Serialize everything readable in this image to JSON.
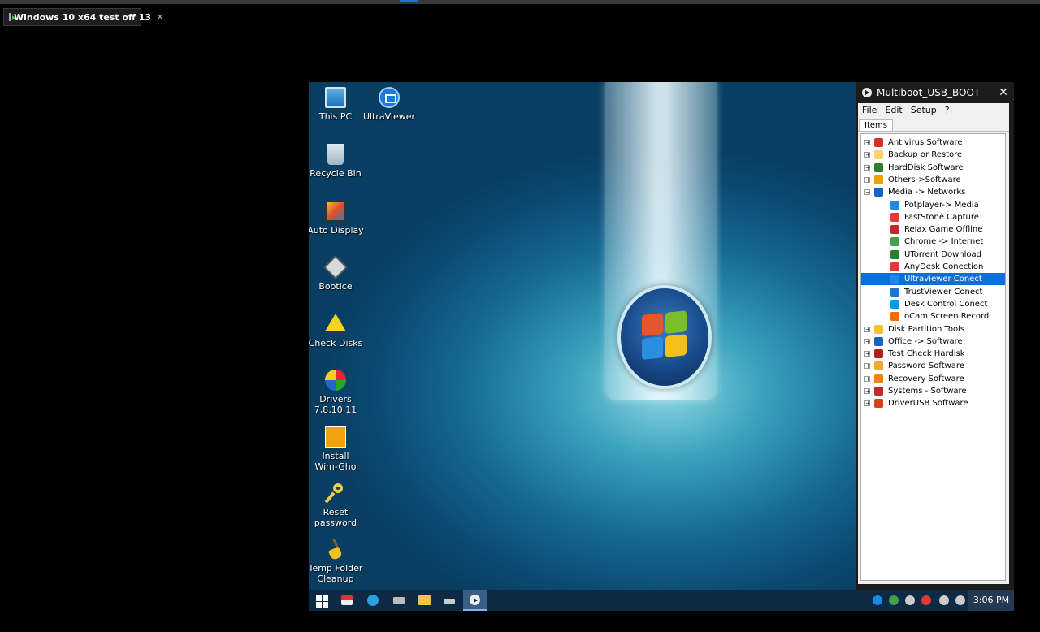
{
  "host": {
    "tab_title": "Windows 10 x64 test off 13",
    "tab_close": "✕"
  },
  "desktop": {
    "icons": [
      {
        "label": "This PC",
        "icon": "computer-icon"
      },
      {
        "label": "UltraViewer",
        "icon": "ultraviewer-icon"
      },
      {
        "label": "Recycle Bin",
        "icon": "recycle-bin-icon"
      },
      {
        "label": "Auto Display",
        "icon": "display-icon"
      },
      {
        "label": "Bootice",
        "icon": "bootice-icon"
      },
      {
        "label": "Check Disks",
        "icon": "warning-disk-icon"
      },
      {
        "label": "Drivers\n7,8,10,11",
        "icon": "drivers-icon"
      },
      {
        "label": "Install\nWim-Gho",
        "icon": "windows-installer-icon"
      },
      {
        "label": "Reset\npassword",
        "icon": "key-icon"
      },
      {
        "label": "Temp Folder\nCleanup",
        "icon": "broom-icon"
      }
    ]
  },
  "multiboot": {
    "title": "Multiboot_USB_BOOT",
    "close": "✕",
    "menu": [
      "File",
      "Edit",
      "Setup",
      "?"
    ],
    "tab": "Items",
    "tree": [
      {
        "label": "Antivirus Software",
        "level": 0,
        "expander": "+",
        "color": "#d32f2f"
      },
      {
        "label": "Backup or Restore",
        "level": 0,
        "expander": "+",
        "color": "#f5d76e"
      },
      {
        "label": "HardDisk Software",
        "level": 0,
        "expander": "+",
        "color": "#2e7d32"
      },
      {
        "label": "Others->Software",
        "level": 0,
        "expander": "+",
        "color": "#f39c12"
      },
      {
        "label": "Media -> Networks",
        "level": 0,
        "expander": "−",
        "color": "#1565c0"
      },
      {
        "label": "Potplayer-> Media",
        "level": 1,
        "expander": "",
        "color": "#1e88e5"
      },
      {
        "label": "FastStone Capture",
        "level": 1,
        "expander": "",
        "color": "#e53935"
      },
      {
        "label": "Relax Game Offline",
        "level": 1,
        "expander": "",
        "color": "#c62828"
      },
      {
        "label": "Chrome -> Internet",
        "level": 1,
        "expander": "",
        "color": "#43a047"
      },
      {
        "label": "UTorrent Download",
        "level": 1,
        "expander": "",
        "color": "#2e7d32"
      },
      {
        "label": "AnyDesk Conection",
        "level": 1,
        "expander": "",
        "color": "#e53935"
      },
      {
        "label": "Ultraviewer Conect",
        "level": 1,
        "expander": "",
        "color": "#1e88e5",
        "selected": true
      },
      {
        "label": "TrustViewer Conect",
        "level": 1,
        "expander": "",
        "color": "#1976d2"
      },
      {
        "label": "Desk Control Conect",
        "level": 1,
        "expander": "",
        "color": "#039be5"
      },
      {
        "label": "oCam Screen Record",
        "level": 1,
        "expander": "",
        "color": "#ef6c00"
      },
      {
        "label": "Disk Partition Tools",
        "level": 0,
        "expander": "+",
        "color": "#fbc02d"
      },
      {
        "label": "Office -> Software",
        "level": 0,
        "expander": "+",
        "color": "#1565c0"
      },
      {
        "label": "Test Check Hardisk",
        "level": 0,
        "expander": "+",
        "color": "#b71c1c"
      },
      {
        "label": "Password Software",
        "level": 0,
        "expander": "+",
        "color": "#f9a825"
      },
      {
        "label": "Recovery Software",
        "level": 0,
        "expander": "+",
        "color": "#f57f17"
      },
      {
        "label": "Systems - Software",
        "level": 0,
        "expander": "+",
        "color": "#c62828"
      },
      {
        "label": "DriverUSB Software",
        "level": 0,
        "expander": "+",
        "color": "#d84315"
      }
    ]
  },
  "taskbar": {
    "clock": "3:06 PM",
    "tray_colors": [
      "#1e88e5",
      "#43a047",
      "#cccccc",
      "#e53935",
      "#cccccc",
      "#cccccc"
    ]
  }
}
